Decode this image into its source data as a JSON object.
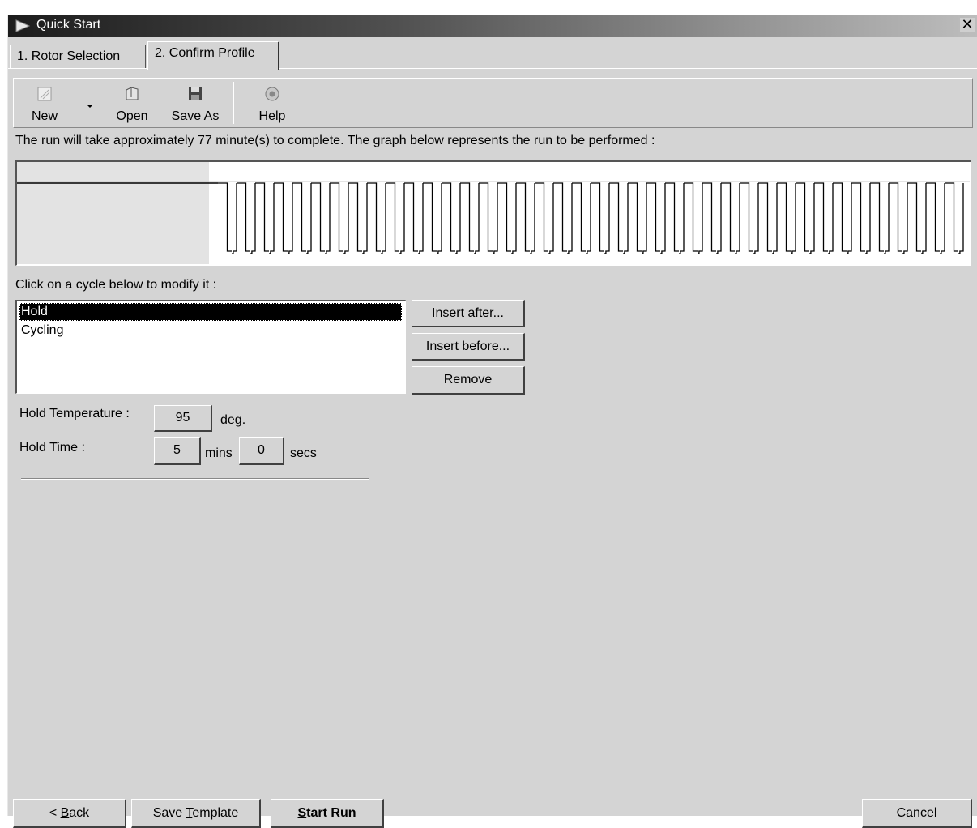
{
  "window": {
    "title": "Quick Start",
    "close_glyph": "✕"
  },
  "tabs": [
    {
      "label": "1. Rotor Selection",
      "active": false
    },
    {
      "label": "2. Confirm Profile",
      "active": true
    }
  ],
  "toolbar": {
    "new_label": "New",
    "open_label": "Open",
    "save_as_label": "Save As",
    "help_label": "Help",
    "icons": {
      "new": "new-document-icon",
      "open": "open-folder-icon",
      "save_as": "floppy-disk-icon",
      "help": "help-icon",
      "dropdown": "dropdown-arrow-icon"
    }
  },
  "info_text": "The run will take approximately 77 minute(s) to complete. The graph below represents the run to be performed :",
  "chart_data": {
    "type": "line",
    "series": [
      {
        "segment": "hold",
        "temperature": 95,
        "minutes": 5,
        "seconds": 0
      },
      {
        "segment": "cycling",
        "cycle_count": 40
      }
    ],
    "title": "",
    "xlabel": "",
    "ylabel": ""
  },
  "cycle_list": {
    "label": "Click on a cycle below to modify it :",
    "items": [
      {
        "label": "Hold",
        "selected": true
      },
      {
        "label": "Cycling",
        "selected": false
      }
    ]
  },
  "cycle_buttons": {
    "insert_after": "Insert after...",
    "insert_before": "Insert before...",
    "remove": "Remove"
  },
  "hold": {
    "temperature_label": "Hold Temperature :",
    "temperature_value": "95",
    "temperature_unit": "deg.",
    "time_label": "Hold Time :",
    "minutes_value": "5",
    "minutes_unit": "mins",
    "seconds_value": "0",
    "seconds_unit": "secs"
  },
  "footer": {
    "back_pre": "< ",
    "back_key": "B",
    "back_post": "ack",
    "save_template_pre": "Save ",
    "save_template_key": "T",
    "save_template_post": "emplate",
    "start_run_key": "S",
    "start_run_post": "tart Run",
    "cancel": "Cancel"
  }
}
